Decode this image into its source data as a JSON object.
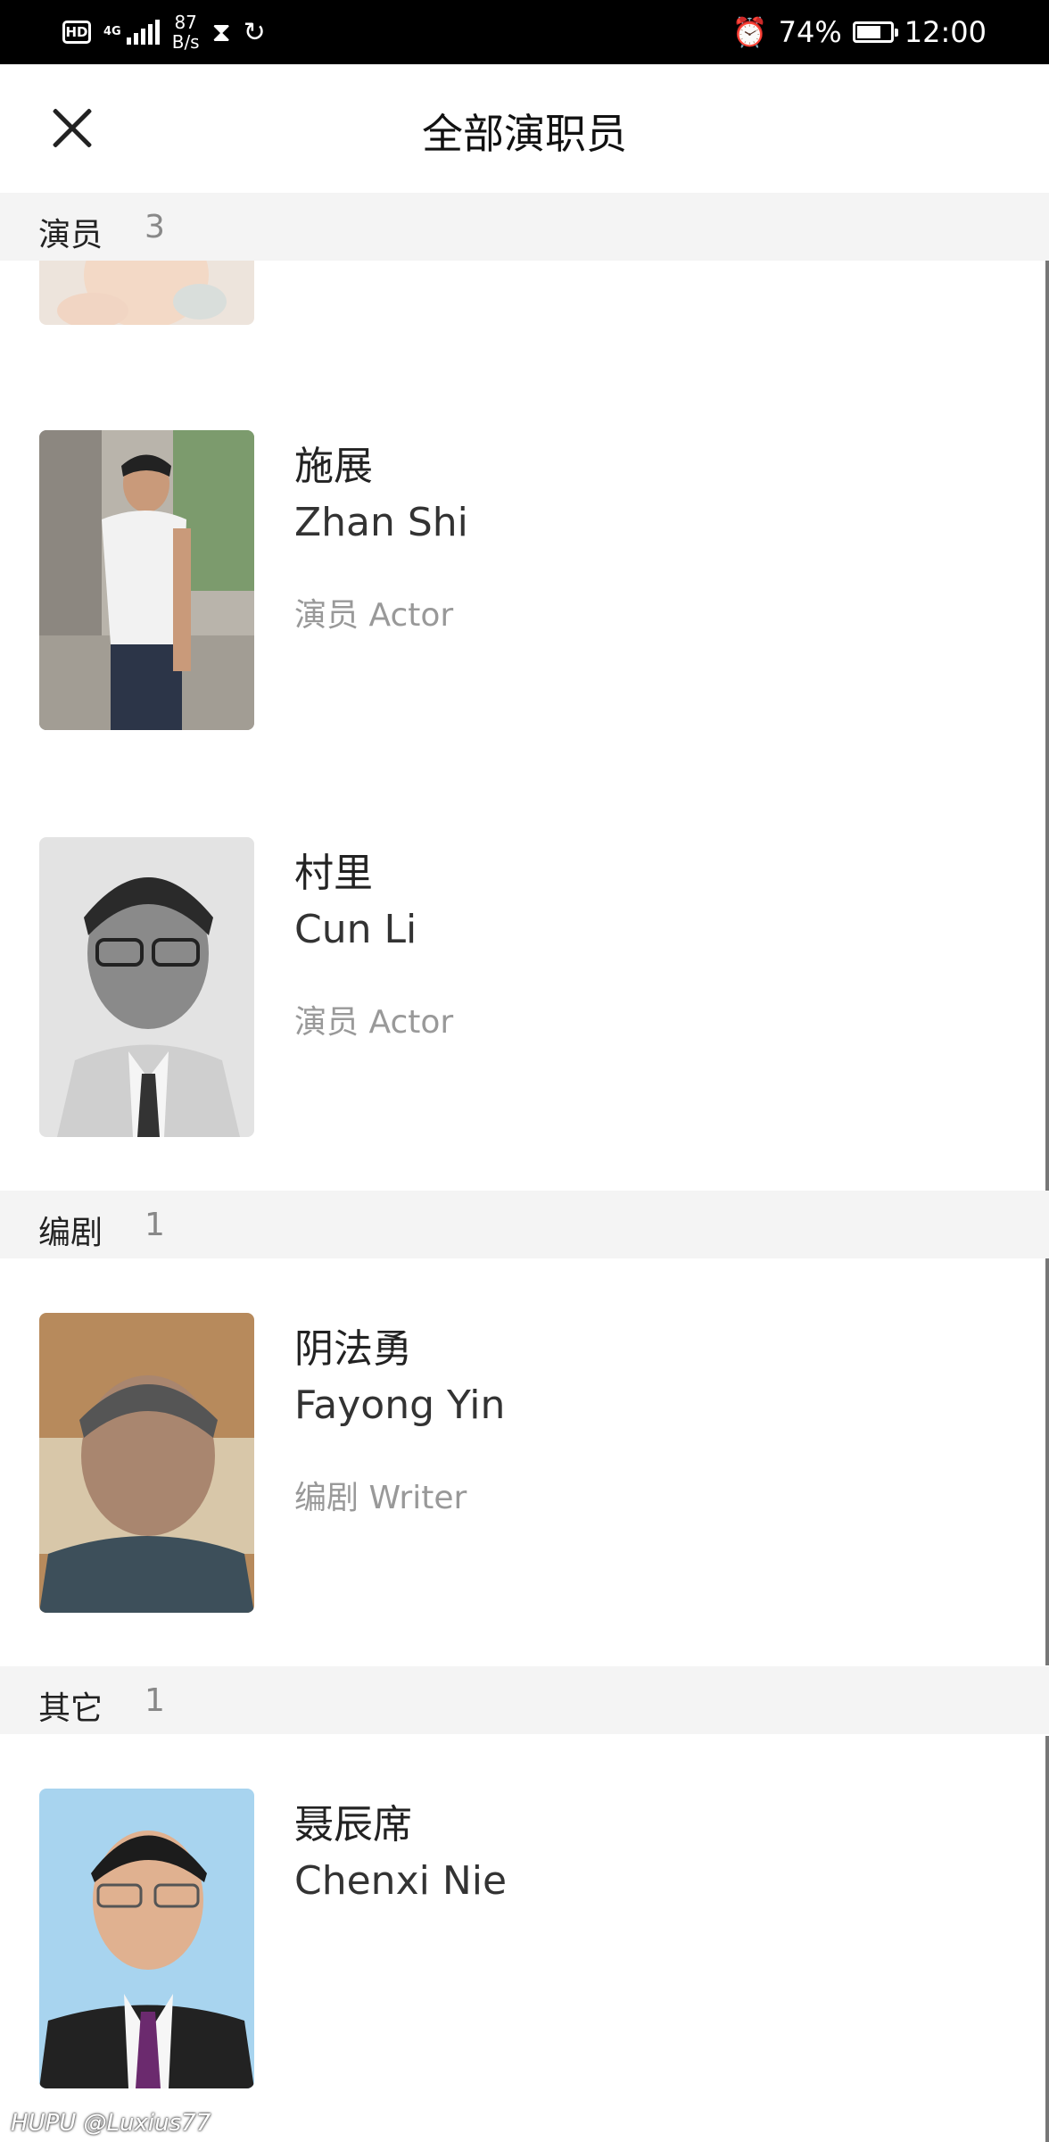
{
  "status_bar": {
    "hd": "HD",
    "network": "4G",
    "speed_value": "87",
    "speed_unit": "B/s",
    "battery_percent": "74%",
    "battery_level": 0.74,
    "time": "12:00"
  },
  "header": {
    "title": "全部演职员"
  },
  "sections": [
    {
      "name": "演员",
      "count": "3",
      "people": [
        {
          "name_cn": "",
          "name_en": "",
          "role": ""
        },
        {
          "name_cn": "施展",
          "name_en": "Zhan Shi",
          "role": "演员 Actor"
        },
        {
          "name_cn": "村里",
          "name_en": "Cun Li",
          "role": "演员 Actor"
        }
      ]
    },
    {
      "name": "编剧",
      "count": "1",
      "people": [
        {
          "name_cn": "阴法勇",
          "name_en": "Fayong Yin",
          "role": "编剧 Writer"
        }
      ]
    },
    {
      "name": "其它",
      "count": "1",
      "people": [
        {
          "name_cn": "聂辰席",
          "name_en": "Chenxi Nie",
          "role": ""
        }
      ]
    }
  ],
  "watermark": "HUPU @Luxius77"
}
